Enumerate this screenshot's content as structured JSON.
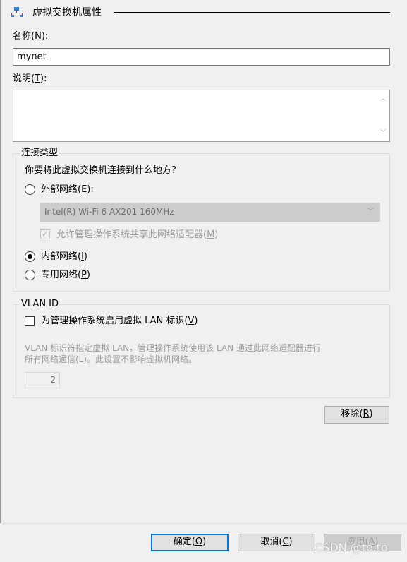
{
  "header": {
    "title": "虚拟交换机属性",
    "icon": "network-switch-icon"
  },
  "name_field": {
    "label_pre": "名称(",
    "label_key": "N",
    "label_post": "):",
    "value": "mynet"
  },
  "desc_field": {
    "label_pre": "说明(",
    "label_key": "T",
    "label_post": "):",
    "value": ""
  },
  "connection": {
    "group_title": "连接类型",
    "question": "你要将此虚拟交换机连接到什么地方?",
    "external": {
      "pre": "外部网络(",
      "key": "E",
      "post": "):",
      "selected": false
    },
    "adapter": "Intel(R) Wi-Fi 6 AX201 160MHz",
    "allow_share": {
      "pre": "允许管理操作系统共享此网络适配器(",
      "key": "M",
      "post": ")",
      "checked": true,
      "enabled": false
    },
    "internal": {
      "pre": "内部网络(",
      "key": "I",
      "post": ")",
      "selected": true
    },
    "private": {
      "pre": "专用网络(",
      "key": "P",
      "post": ")",
      "selected": false
    }
  },
  "vlan": {
    "group_title": "VLAN ID",
    "enable": {
      "pre": "为管理操作系统启用虚拟 LAN 标识(",
      "key": "V",
      "post": ")",
      "checked": false
    },
    "desc_line1": "VLAN 标识符指定虚拟 LAN，管理操作系统使用该 LAN 通过此网络适配器进行",
    "desc_line2": "所有网络通信(L)。此设置不影响虚拟机网络。",
    "value": "2"
  },
  "buttons": {
    "remove": {
      "pre": "移除(",
      "key": "R",
      "post": ")"
    },
    "ok": {
      "pre": "确定(",
      "key": "O",
      "post": ")"
    },
    "cancel": {
      "pre": "取消(",
      "key": "C",
      "post": ")"
    },
    "apply": {
      "pre": "应用(",
      "key": "A",
      "post": ")"
    }
  },
  "watermark": "CSDN @to.to",
  "colors": {
    "accent": "#0078d7",
    "background": "#f0f0f0",
    "disabled_text": "#9b9b9b"
  }
}
